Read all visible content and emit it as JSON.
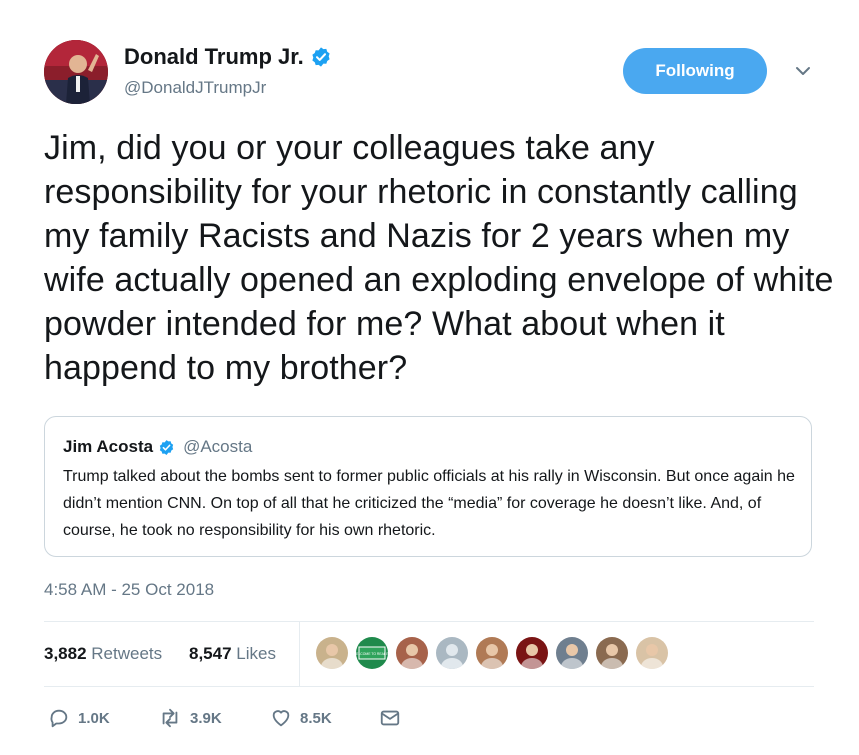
{
  "author": {
    "display_name": "Donald Trump Jr.",
    "handle": "@DonaldJTrumpJr",
    "verified": true
  },
  "follow_button": {
    "label": "Following"
  },
  "tweet": {
    "text": "Jim, did you or your colleagues take any responsibility for your rhetoric in constantly calling my family Racists and Nazis for 2 years when my wife actually opened an exploding envelope of white powder intended for me? What about when it happend to my brother?",
    "timestamp": "4:58 AM - 25 Oct 2018"
  },
  "quoted_tweet": {
    "display_name": "Jim Acosta",
    "handle": "@Acosta",
    "verified": true,
    "text": "Trump talked about the bombs sent to former public officials at his rally in Wisconsin. But once again he didn’t mention CNN. On top of all that he criticized the “media” for coverage he doesn’t like. And, of course, he took no responsibility for his own rhetoric."
  },
  "stats": {
    "retweets_count": "3,882",
    "retweets_label": "Retweets",
    "likes_count": "8,547",
    "likes_label": "Likes"
  },
  "likers": [
    {
      "icon": "avatar-blonde",
      "color": "#c9b28c"
    },
    {
      "icon": "avatar-welcome-to-reality",
      "color": "#1f8a4c",
      "text": "WELCOME TO REALITY"
    },
    {
      "icon": "avatar-man",
      "color": "#a7624a"
    },
    {
      "icon": "avatar-default",
      "color": "#aab8c2"
    },
    {
      "icon": "avatar-couple",
      "color": "#b07a55"
    },
    {
      "icon": "avatar-red-lion",
      "color": "#7a1414"
    },
    {
      "icon": "avatar-group",
      "color": "#6f7f8f"
    },
    {
      "icon": "avatar-couple-2",
      "color": "#8a6a50"
    },
    {
      "icon": "avatar-woman",
      "color": "#d9c3a6"
    }
  ],
  "actions": {
    "reply_count": "1.0K",
    "retweet_count": "3.9K",
    "like_count": "8.5K"
  },
  "colors": {
    "accent": "#4aa8f0",
    "muted_text": "#657786",
    "verified_badge": "#1da1f2"
  }
}
